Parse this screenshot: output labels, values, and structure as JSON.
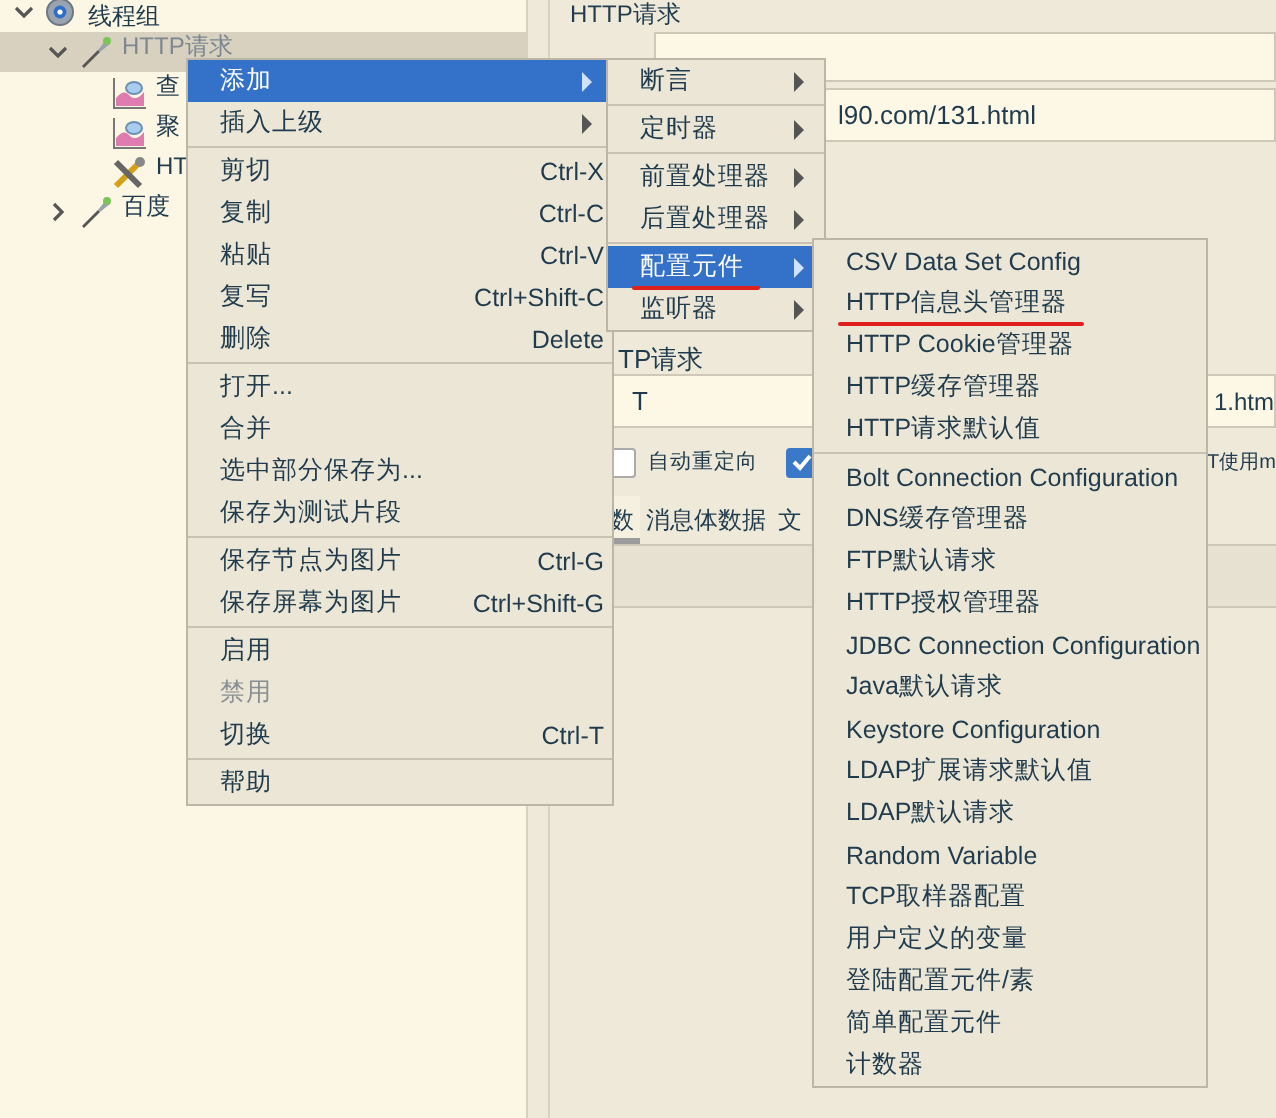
{
  "tree": [
    {
      "label": "线程组",
      "kind": "thread-group",
      "expanded": true,
      "selected": false,
      "disabled": false,
      "children": [
        {
          "label": "HTTP请求",
          "kind": "sampler",
          "expanded": true,
          "selected": true,
          "disabled": true,
          "children": [
            {
              "label": "查",
              "kind": "listener",
              "selected": false,
              "disabled": false
            },
            {
              "label": "聚",
              "kind": "listener",
              "selected": false,
              "disabled": false
            },
            {
              "label": "HT",
              "kind": "config",
              "selected": false,
              "disabled": false
            }
          ]
        },
        {
          "label": "百度",
          "kind": "sampler",
          "expanded": false,
          "selected": false,
          "disabled": false
        }
      ]
    }
  ],
  "panel": {
    "title": "HTTP请求",
    "url_fragment": "l90.com/131.html",
    "group_label": "TP请求",
    "method_fragment": "T",
    "path_fragment": "1.htm",
    "checkboxes": [
      {
        "label": "自动重定向",
        "checked": false
      },
      {
        "checked": true
      }
    ],
    "option_fragment": "T使用m",
    "tabs": [
      {
        "label": "数",
        "selected": true
      },
      {
        "label": "消息体数据",
        "selected": false
      },
      {
        "label": "文",
        "selected": false
      }
    ]
  },
  "menus": [
    {
      "items": [
        {
          "kind": "item",
          "label": "添加",
          "submenu": true,
          "selected": true,
          "disabled": false
        },
        {
          "kind": "item",
          "label": "插入上级",
          "submenu": true,
          "selected": false,
          "disabled": false
        },
        {
          "kind": "separator"
        },
        {
          "kind": "item",
          "label": "剪切",
          "shortcut": "Ctrl-X",
          "selected": false,
          "disabled": false
        },
        {
          "kind": "item",
          "label": "复制",
          "shortcut": "Ctrl-C",
          "selected": false,
          "disabled": false
        },
        {
          "kind": "item",
          "label": "粘贴",
          "shortcut": "Ctrl-V",
          "selected": false,
          "disabled": false
        },
        {
          "kind": "item",
          "label": "复写",
          "shortcut": "Ctrl+Shift-C",
          "selected": false,
          "disabled": false
        },
        {
          "kind": "item",
          "label": "删除",
          "shortcut": "Delete",
          "selected": false,
          "disabled": false
        },
        {
          "kind": "separator"
        },
        {
          "kind": "item",
          "label": "打开...",
          "selected": false,
          "disabled": false
        },
        {
          "kind": "item",
          "label": "合并",
          "selected": false,
          "disabled": false
        },
        {
          "kind": "item",
          "label": "选中部分保存为...",
          "selected": false,
          "disabled": false
        },
        {
          "kind": "item",
          "label": "保存为测试片段",
          "selected": false,
          "disabled": false
        },
        {
          "kind": "separator"
        },
        {
          "kind": "item",
          "label": "保存节点为图片",
          "shortcut": "Ctrl-G",
          "selected": false,
          "disabled": false
        },
        {
          "kind": "item",
          "label": "保存屏幕为图片",
          "shortcut": "Ctrl+Shift-G",
          "selected": false,
          "disabled": false
        },
        {
          "kind": "separator"
        },
        {
          "kind": "item",
          "label": "启用",
          "selected": false,
          "disabled": false
        },
        {
          "kind": "item",
          "label": "禁用",
          "selected": false,
          "disabled": true
        },
        {
          "kind": "item",
          "label": "切换",
          "shortcut": "Ctrl-T",
          "selected": false,
          "disabled": false
        },
        {
          "kind": "separator"
        },
        {
          "kind": "item",
          "label": "帮助",
          "selected": false,
          "disabled": false
        }
      ]
    },
    {
      "items": [
        {
          "kind": "item",
          "label": "断言",
          "submenu": true,
          "selected": false,
          "annotated": false
        },
        {
          "kind": "separator"
        },
        {
          "kind": "item",
          "label": "定时器",
          "submenu": true,
          "selected": false,
          "annotated": false
        },
        {
          "kind": "separator"
        },
        {
          "kind": "item",
          "label": "前置处理器",
          "submenu": true,
          "selected": false,
          "annotated": false
        },
        {
          "kind": "item",
          "label": "后置处理器",
          "submenu": true,
          "selected": false,
          "annotated": false
        },
        {
          "kind": "separator"
        },
        {
          "kind": "item",
          "label": "配置元件",
          "submenu": true,
          "selected": true,
          "annotated": true
        },
        {
          "kind": "item",
          "label": "监听器",
          "submenu": true,
          "selected": false,
          "annotated": false
        }
      ]
    },
    {
      "items": [
        {
          "kind": "item",
          "label": "CSV Data Set Config",
          "selected": false,
          "annotated": false
        },
        {
          "kind": "item",
          "label": "HTTP信息头管理器",
          "selected": false,
          "annotated": true
        },
        {
          "kind": "item",
          "label": "HTTP Cookie管理器",
          "selected": false,
          "annotated": false
        },
        {
          "kind": "item",
          "label": "HTTP缓存管理器",
          "selected": false,
          "annotated": false
        },
        {
          "kind": "item",
          "label": "HTTP请求默认值",
          "selected": false,
          "annotated": false
        },
        {
          "kind": "separator"
        },
        {
          "kind": "item",
          "label": "Bolt Connection Configuration",
          "selected": false,
          "annotated": false
        },
        {
          "kind": "item",
          "label": "DNS缓存管理器",
          "selected": false,
          "annotated": false
        },
        {
          "kind": "item",
          "label": "FTP默认请求",
          "selected": false,
          "annotated": false
        },
        {
          "kind": "item",
          "label": "HTTP授权管理器",
          "selected": false,
          "annotated": false
        },
        {
          "kind": "item",
          "label": "JDBC Connection Configuration",
          "selected": false,
          "annotated": false
        },
        {
          "kind": "item",
          "label": "Java默认请求",
          "selected": false,
          "annotated": false
        },
        {
          "kind": "item",
          "label": "Keystore Configuration",
          "selected": false,
          "annotated": false
        },
        {
          "kind": "item",
          "label": "LDAP扩展请求默认值",
          "selected": false,
          "annotated": false
        },
        {
          "kind": "item",
          "label": "LDAP默认请求",
          "selected": false,
          "annotated": false
        },
        {
          "kind": "item",
          "label": "Random Variable",
          "selected": false,
          "annotated": false
        },
        {
          "kind": "item",
          "label": "TCP取样器配置",
          "selected": false,
          "annotated": false
        },
        {
          "kind": "item",
          "label": "用户定义的变量",
          "selected": false,
          "annotated": false
        },
        {
          "kind": "item",
          "label": "登陆配置元件/素",
          "selected": false,
          "annotated": false
        },
        {
          "kind": "item",
          "label": "简单配置元件",
          "selected": false,
          "annotated": false
        },
        {
          "kind": "item",
          "label": "计数器",
          "selected": false,
          "annotated": false
        }
      ]
    }
  ]
}
